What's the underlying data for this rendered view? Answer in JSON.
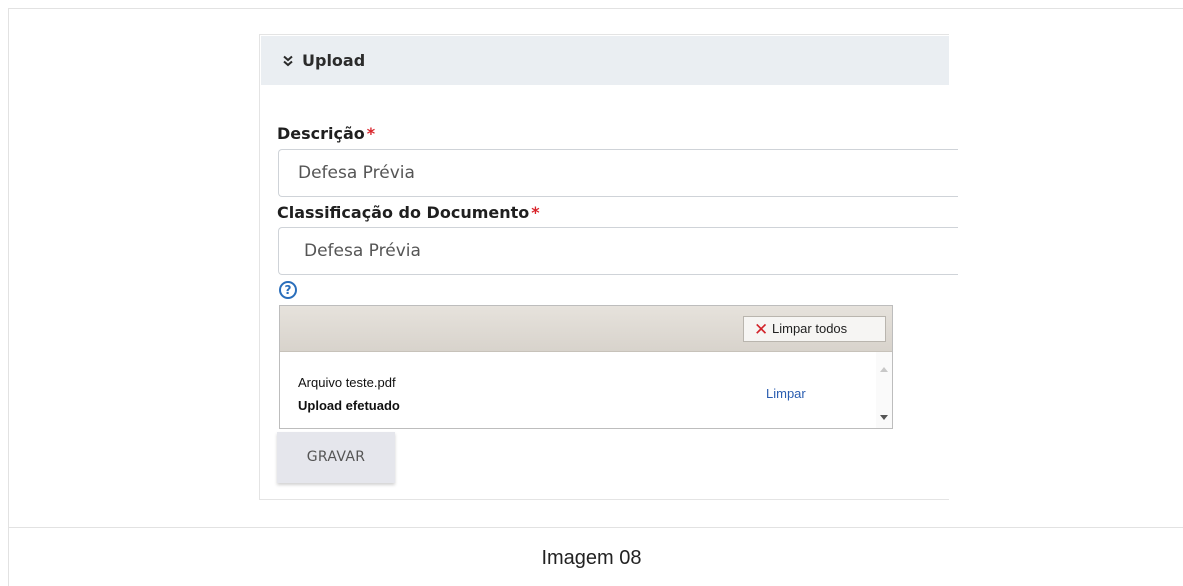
{
  "panel": {
    "title": "Upload",
    "icon": "double-chevron-down-icon"
  },
  "form": {
    "descricao": {
      "label": "Descrição",
      "required_mark": "*",
      "value": "Defesa Prévia"
    },
    "classificacao": {
      "label": "Classificação do Documento",
      "required_mark": "*",
      "value": "Defesa Prévia"
    },
    "help_glyph": "?"
  },
  "uploader": {
    "clear_all_label": "Limpar todos",
    "clear_all_glyph": "✕",
    "files": [
      {
        "name": "Arquivo teste.pdf",
        "status": "Upload efetuado",
        "action_label": "Limpar"
      }
    ]
  },
  "actions": {
    "save_label": "GRAVAR"
  },
  "caption": "Imagem 08",
  "colors": {
    "required": "#d9242b",
    "link": "#2a5db0",
    "clear_icon": "#d2232a",
    "header_bg": "#eaeef2"
  }
}
